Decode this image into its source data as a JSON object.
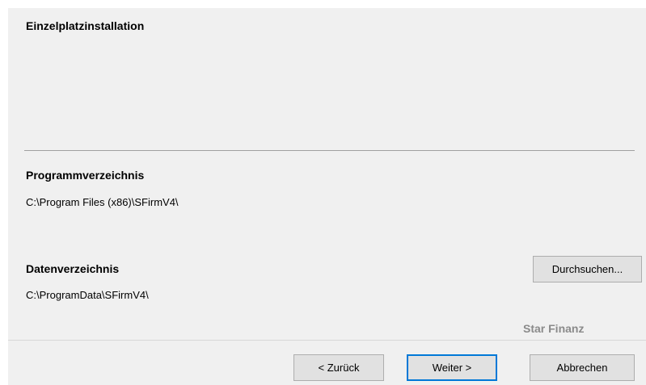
{
  "header": {
    "title": "Einzelplatzinstallation"
  },
  "program_directory": {
    "label": "Programmverzeichnis",
    "path": "C:\\Program Files (x86)\\SFirmV4\\"
  },
  "data_directory": {
    "label": "Datenverzeichnis",
    "path": "C:\\ProgramData\\SFirmV4\\",
    "browse_label": "Durchsuchen..."
  },
  "branding": {
    "text": "Star Finanz"
  },
  "footer": {
    "back_label": "< Zurück",
    "next_label": "Weiter >",
    "cancel_label": "Abbrechen"
  },
  "colors": {
    "panel_background": "#f0f0f0",
    "default_button_border": "#0078d7",
    "branding_text": "#8a8a8a"
  }
}
